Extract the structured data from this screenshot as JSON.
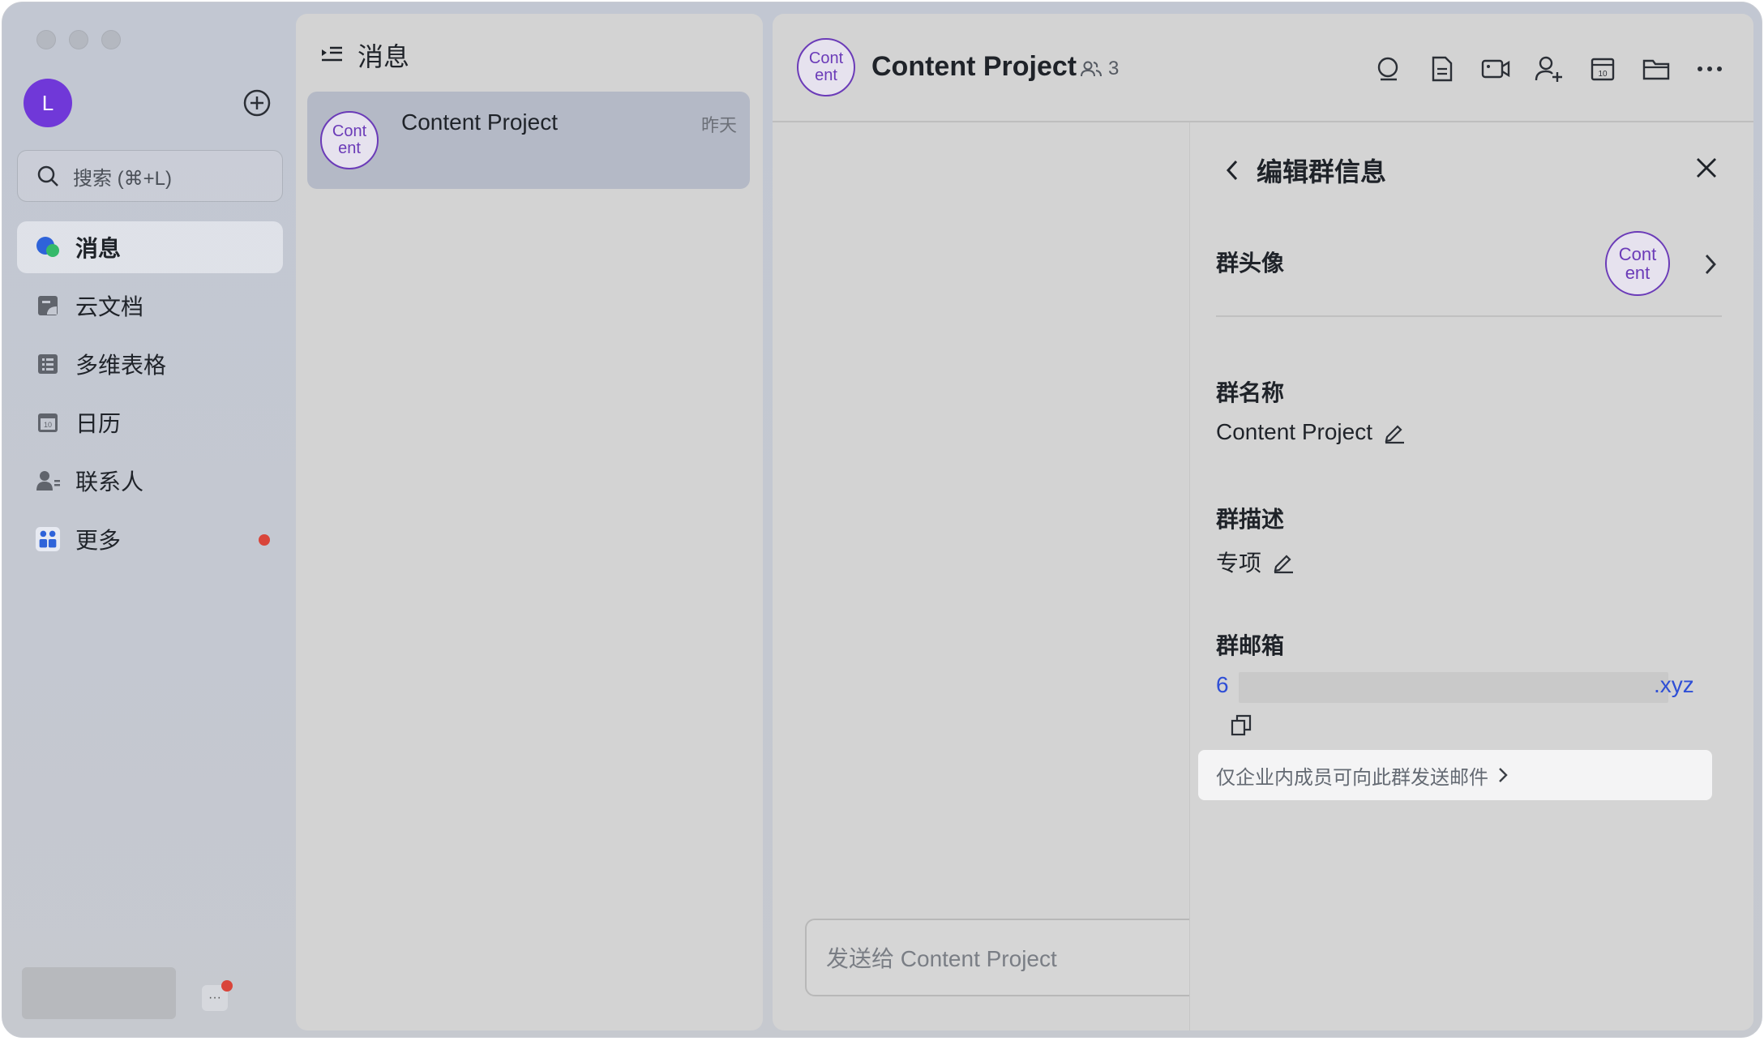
{
  "sidebar": {
    "user_initial": "L",
    "search_placeholder": "搜索 (⌘+L)",
    "nav": [
      {
        "label": "消息",
        "icon": "message-bubble-icon",
        "active": true
      },
      {
        "label": "云文档",
        "icon": "cloud-doc-icon"
      },
      {
        "label": "多维表格",
        "icon": "base-table-icon"
      },
      {
        "label": "日历",
        "icon": "calendar-icon"
      },
      {
        "label": "联系人",
        "icon": "contacts-icon"
      },
      {
        "label": "更多",
        "icon": "more-apps-icon",
        "badge": true
      }
    ],
    "more_button_label": "···"
  },
  "message_list": {
    "title": "消息",
    "items": [
      {
        "avatar_text_1": "Cont",
        "avatar_text_2": "ent",
        "name": "Content Project",
        "time": "昨天"
      }
    ]
  },
  "chat": {
    "avatar_text_1": "Cont",
    "avatar_text_2": "ent",
    "title": "Content Project",
    "member_count": "3",
    "toolbar_icons": [
      "search-chat-icon",
      "document-icon",
      "video-call-icon",
      "add-member-icon",
      "calendar-icon",
      "folder-icon",
      "more-icon"
    ],
    "composer_placeholder": "发送给 Content Project"
  },
  "edit_panel": {
    "title": "编辑群信息",
    "avatar_label": "群头像",
    "avatar_text_1": "Cont",
    "avatar_text_2": "ent",
    "name_label": "群名称",
    "name_value": "Content Project",
    "desc_label": "群描述",
    "desc_value": "专项",
    "mail_label": "群邮箱",
    "mail_start": "6",
    "mail_end": ".xyz",
    "mail_note": "仅企业内成员可向此群发送邮件"
  },
  "colors": {
    "accent_purple": "#6b3bb8",
    "user_avatar": "#7038d8",
    "link_blue": "#2f4fd6",
    "badge_red": "#d9453a"
  }
}
